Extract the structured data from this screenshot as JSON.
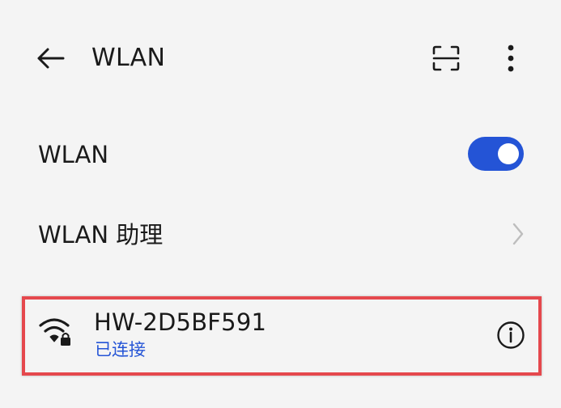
{
  "toolbar": {
    "title": "WLAN",
    "back_icon": "arrow-left-icon",
    "scan_icon": "scan-icon",
    "more_icon": "more-vertical-icon"
  },
  "settings": {
    "wlan_toggle": {
      "label": "WLAN",
      "state": "on",
      "accent": "#2454d6"
    },
    "assistant": {
      "label": "WLAN 助理",
      "icon": "chevron-right-icon"
    }
  },
  "network": {
    "ssid": "HW-2D5BF591",
    "status": "已连接",
    "signal_icon": "wifi-locked-icon",
    "info_icon": "info-icon",
    "status_color": "#2454d6",
    "highlight_color": "#e5484d"
  }
}
